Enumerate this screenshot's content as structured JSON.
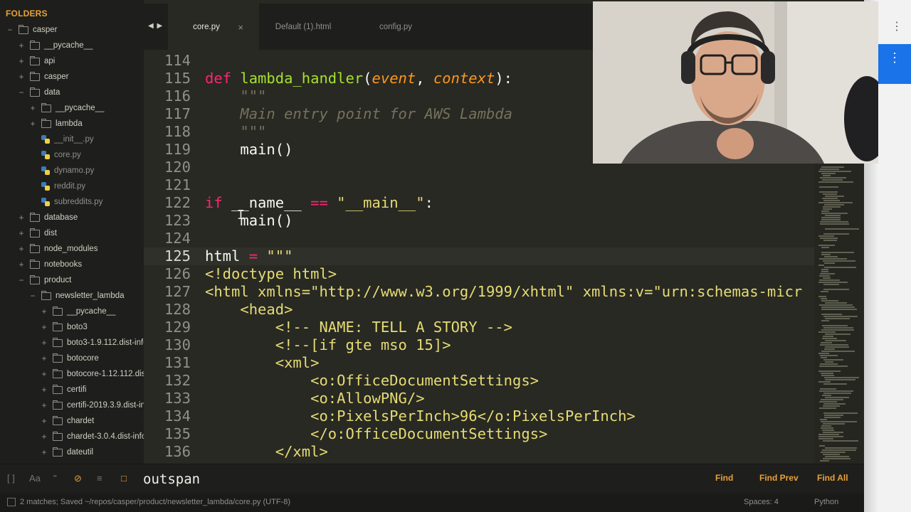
{
  "sidebar": {
    "header": "FOLDERS",
    "tree": [
      {
        "label": "casper",
        "type": "folder",
        "depth": 0,
        "expanded": true
      },
      {
        "label": "__pycache__",
        "type": "folder",
        "depth": 1,
        "expanded": false
      },
      {
        "label": "api",
        "type": "folder",
        "depth": 1,
        "expanded": false
      },
      {
        "label": "casper",
        "type": "folder",
        "depth": 1,
        "expanded": false
      },
      {
        "label": "data",
        "type": "folder",
        "depth": 1,
        "expanded": true
      },
      {
        "label": "__pycache__",
        "type": "folder",
        "depth": 2,
        "expanded": false
      },
      {
        "label": "lambda",
        "type": "folder",
        "depth": 2,
        "expanded": false
      },
      {
        "label": "__init__.py",
        "type": "file",
        "depth": 2
      },
      {
        "label": "core.py",
        "type": "file",
        "depth": 2
      },
      {
        "label": "dynamo.py",
        "type": "file",
        "depth": 2
      },
      {
        "label": "reddit.py",
        "type": "file",
        "depth": 2
      },
      {
        "label": "subreddits.py",
        "type": "file",
        "depth": 2
      },
      {
        "label": "database",
        "type": "folder",
        "depth": 1,
        "expanded": false
      },
      {
        "label": "dist",
        "type": "folder",
        "depth": 1,
        "expanded": false
      },
      {
        "label": "node_modules",
        "type": "folder",
        "depth": 1,
        "expanded": false
      },
      {
        "label": "notebooks",
        "type": "folder",
        "depth": 1,
        "expanded": false
      },
      {
        "label": "product",
        "type": "folder",
        "depth": 1,
        "expanded": true
      },
      {
        "label": "newsletter_lambda",
        "type": "folder",
        "depth": 2,
        "expanded": true
      },
      {
        "label": "__pycache__",
        "type": "folder",
        "depth": 3,
        "expanded": false
      },
      {
        "label": "boto3",
        "type": "folder",
        "depth": 3,
        "expanded": false
      },
      {
        "label": "boto3-1.9.112.dist-info",
        "type": "folder",
        "depth": 3,
        "expanded": false
      },
      {
        "label": "botocore",
        "type": "folder",
        "depth": 3,
        "expanded": false
      },
      {
        "label": "botocore-1.12.112.dist-info",
        "type": "folder",
        "depth": 3,
        "expanded": false
      },
      {
        "label": "certifi",
        "type": "folder",
        "depth": 3,
        "expanded": false
      },
      {
        "label": "certifi-2019.3.9.dist-info",
        "type": "folder",
        "depth": 3,
        "expanded": false
      },
      {
        "label": "chardet",
        "type": "folder",
        "depth": 3,
        "expanded": false
      },
      {
        "label": "chardet-3.0.4.dist-info",
        "type": "folder",
        "depth": 3,
        "expanded": false
      },
      {
        "label": "dateutil",
        "type": "folder",
        "depth": 3,
        "expanded": false
      }
    ]
  },
  "tabs": {
    "nav": "◀ ▶",
    "close_glyph": "×",
    "items": [
      {
        "label": "core.py",
        "active": true
      },
      {
        "label": "Default (1).html",
        "active": false
      },
      {
        "label": "config.py",
        "active": false
      }
    ]
  },
  "editor": {
    "current_line": "125",
    "lines": [
      {
        "num": "114",
        "tokens": []
      },
      {
        "num": "115",
        "tokens": [
          {
            "t": "def",
            "c": "kw"
          },
          {
            "t": " "
          },
          {
            "t": "lambda_handler",
            "c": "fn"
          },
          {
            "t": "("
          },
          {
            "t": "event",
            "c": "param"
          },
          {
            "t": ", "
          },
          {
            "t": "context",
            "c": "param"
          },
          {
            "t": "):"
          }
        ]
      },
      {
        "num": "116",
        "tokens": [
          {
            "t": "    "
          },
          {
            "t": "\"\"\"",
            "c": "cmt"
          }
        ]
      },
      {
        "num": "117",
        "tokens": [
          {
            "t": "    "
          },
          {
            "t": "Main entry point for AWS Lambda",
            "c": "cmt"
          }
        ]
      },
      {
        "num": "118",
        "tokens": [
          {
            "t": "    "
          },
          {
            "t": "\"\"\"",
            "c": "cmt"
          }
        ]
      },
      {
        "num": "119",
        "tokens": [
          {
            "t": "    main()"
          }
        ]
      },
      {
        "num": "120",
        "tokens": []
      },
      {
        "num": "121",
        "tokens": []
      },
      {
        "num": "122",
        "tokens": [
          {
            "t": "if",
            "c": "kw"
          },
          {
            "t": " __name__ "
          },
          {
            "t": "==",
            "c": "kw"
          },
          {
            "t": " "
          },
          {
            "t": "\"__main__\"",
            "c": "str"
          },
          {
            "t": ":"
          }
        ]
      },
      {
        "num": "123",
        "tokens": [
          {
            "t": "    main()"
          }
        ]
      },
      {
        "num": "124",
        "tokens": []
      },
      {
        "num": "125",
        "tokens": [
          {
            "t": "html "
          },
          {
            "t": "=",
            "c": "kw"
          },
          {
            "t": " "
          },
          {
            "t": "\"\"\"",
            "c": "str"
          }
        ]
      },
      {
        "num": "126",
        "tokens": [
          {
            "t": "<!doctype html>",
            "c": "str"
          }
        ]
      },
      {
        "num": "127",
        "tokens": [
          {
            "t": "<html xmlns=\"http://www.w3.org/1999/xhtml\" xmlns:v=\"urn:schemas-micr",
            "c": "str"
          }
        ]
      },
      {
        "num": "128",
        "tokens": [
          {
            "t": "    <head>",
            "c": "str"
          }
        ]
      },
      {
        "num": "129",
        "tokens": [
          {
            "t": "        <!-- NAME: TELL A STORY -->",
            "c": "str"
          }
        ]
      },
      {
        "num": "130",
        "tokens": [
          {
            "t": "        <!--[if gte mso 15]>",
            "c": "str"
          }
        ]
      },
      {
        "num": "131",
        "tokens": [
          {
            "t": "        <xml>",
            "c": "str"
          }
        ]
      },
      {
        "num": "132",
        "tokens": [
          {
            "t": "            <o:OfficeDocumentSettings>",
            "c": "str"
          }
        ]
      },
      {
        "num": "133",
        "tokens": [
          {
            "t": "            <o:AllowPNG/>",
            "c": "str"
          }
        ]
      },
      {
        "num": "134",
        "tokens": [
          {
            "t": "            <o:PixelsPerInch>96</o:PixelsPerInch>",
            "c": "str"
          }
        ]
      },
      {
        "num": "135",
        "tokens": [
          {
            "t": "            </o:OfficeDocumentSettings>",
            "c": "str"
          }
        ]
      },
      {
        "num": "136",
        "tokens": [
          {
            "t": "        </xml>",
            "c": "str"
          }
        ]
      }
    ]
  },
  "find": {
    "query": "outspan",
    "option_icons": [
      "regex-icon",
      "case-sensitive-icon",
      "whole-word-icon",
      "wrap-icon",
      "in-selection-icon",
      "highlight-matches-icon"
    ],
    "buttons": {
      "find": "Find",
      "find_prev": "Find Prev",
      "find_all": "Find All"
    }
  },
  "status": {
    "message": "2 matches; Saved ~/repos/casper/product/newsletter_lambda/core.py (UTF-8)",
    "spaces": "Spaces: 4",
    "syntax": "Python"
  },
  "colors": {
    "background": "#282923",
    "sidebar": "#1e1f1c",
    "keyword": "#f92672",
    "function": "#a6e22e",
    "parameter": "#fd971f",
    "string": "#e6db74",
    "comment": "#75715e",
    "accent": "#e8a13a"
  }
}
